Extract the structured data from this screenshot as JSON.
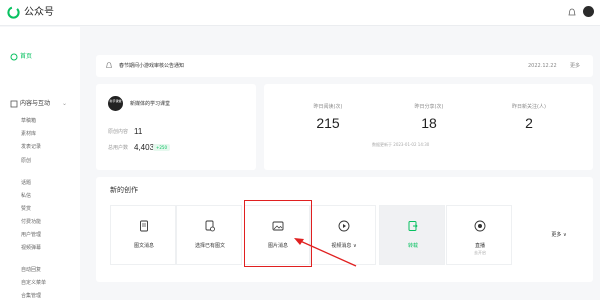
{
  "app": {
    "title": "公众号"
  },
  "colors": {
    "brand": "#07c160",
    "highlight": "#e02020"
  },
  "icons": {
    "logo": "wechat-logo-icon",
    "bell": "bell-icon"
  },
  "sidebar": {
    "home": "首页",
    "group_label": "内容与互动",
    "items": [
      "草稿箱",
      "素材库",
      "发表记录",
      "原创",
      "话题",
      "私信",
      "赞赏",
      "付费功能",
      "用户管理",
      "视频弹幕",
      "自动回复",
      "自定义菜单",
      "合集管理"
    ]
  },
  "notice": {
    "text": "春节期间小游戏审核公告通知",
    "date": "2022.12.22",
    "more": "更多"
  },
  "account": {
    "avatar_text": "新手课堂",
    "name": "新媒体的学习课堂",
    "articles_label": "原创内容",
    "articles_value": "11",
    "followers_label": "总用户数",
    "followers_value": "4,403",
    "growth_badge": "+250"
  },
  "stats": {
    "items": [
      {
        "label": "昨日阅读(次)",
        "value": "215"
      },
      {
        "label": "昨日分享(次)",
        "value": "18"
      },
      {
        "label": "昨日新关注(人)",
        "value": "2"
      }
    ],
    "note": "数据更新于 2023-01-02 14:30"
  },
  "create": {
    "title": "新的创作",
    "tiles": [
      {
        "label": "图文消息",
        "sub": "",
        "icon": "document-icon"
      },
      {
        "label": "选择已有图文",
        "sub": "",
        "icon": "copy-document-icon"
      },
      {
        "label": "图片消息",
        "sub": "",
        "icon": "image-icon"
      },
      {
        "label": "视频消息 ∨",
        "sub": "",
        "icon": "play-icon"
      },
      {
        "label": "转载",
        "sub": "",
        "icon": "export-icon"
      },
      {
        "label": "直播",
        "sub": "去开启",
        "icon": "live-icon"
      }
    ],
    "more": "更多 ∨"
  }
}
